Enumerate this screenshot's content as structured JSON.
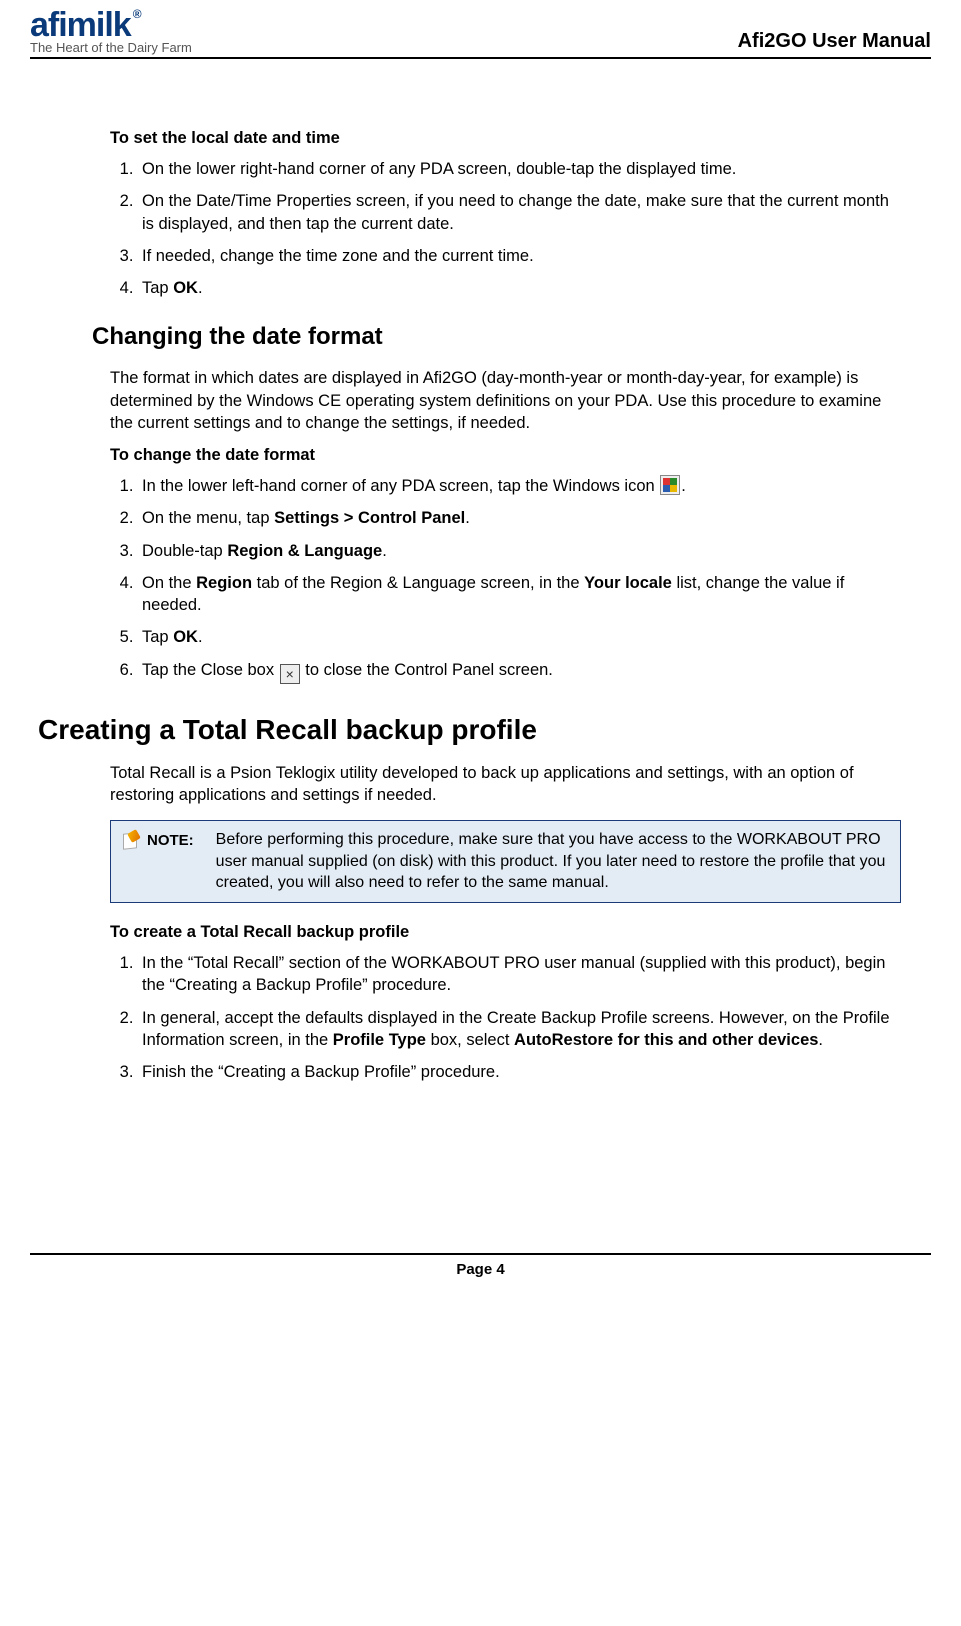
{
  "header": {
    "logo_text": "afimilk",
    "logo_reg": "®",
    "tagline": "The Heart of the Dairy Farm",
    "manual_title": "Afi2GO User Manual"
  },
  "s1": {
    "title": "To set the local date and time",
    "step1": "On the lower right-hand corner of any PDA screen, double-tap the displayed time.",
    "step2": "On the Date/Time Properties screen, if you need to change the date, make sure that the current month is displayed, and then tap the current date.",
    "step3": "If needed, change the time zone and the current time.",
    "step4_pre": "Tap ",
    "step4_b": "OK",
    "step4_post": "."
  },
  "s2": {
    "h": "Changing the date format",
    "intro": "The format in which dates are displayed in Afi2GO (day-month-year or month-day-year, for example) is determined by the Windows CE operating system definitions on your PDA.  Use this procedure to examine the current settings and to change the settings, if needed.",
    "title2": "To change the date format",
    "step1_pre": "In the lower left-hand corner of any PDA screen, tap the Windows icon ",
    "step1_post": ".",
    "step2_pre": "On the menu, tap ",
    "step2_b": "Settings > Control Panel",
    "step2_post": ".",
    "step3_pre": "Double-tap ",
    "step3_b": "Region & Language",
    "step3_post": ".",
    "step4_pre": "On the ",
    "step4_b1": "Region",
    "step4_mid": " tab of the Region & Language screen, in the ",
    "step4_b2": "Your locale",
    "step4_post": " list, change the value if needed.",
    "step5_pre": "Tap ",
    "step5_b": "OK",
    "step5_post": ".",
    "step6_pre": "Tap the Close box ",
    "step6_post": " to close the Control Panel screen."
  },
  "s3": {
    "h": "Creating a Total Recall backup profile",
    "intro": "Total Recall is a Psion Teklogix utility developed to back up applications and settings, with an option of restoring applications and settings if needed.",
    "note_label": "NOTE:",
    "note_text": "Before performing this procedure, make sure that you have access to the WORKABOUT PRO user manual supplied (on disk) with this product.  If you later need to restore the profile that you created, you will also need to refer to the same manual.",
    "title2": "To create a Total Recall backup profile",
    "step1": "In the “Total Recall” section of the WORKABOUT PRO user manual (supplied with this product), begin the “Creating a Backup Profile” procedure.",
    "step2_pre": "In general, accept the defaults displayed in the Create Backup Profile screens.  However, on the Profile Information screen, in the ",
    "step2_b1": "Profile Type",
    "step2_mid": " box, select ",
    "step2_b2": "AutoRestore for this and other devices",
    "step2_post": ".",
    "step3": "Finish the “Creating a Backup Profile” procedure."
  },
  "footer": {
    "page": "Page 4"
  }
}
